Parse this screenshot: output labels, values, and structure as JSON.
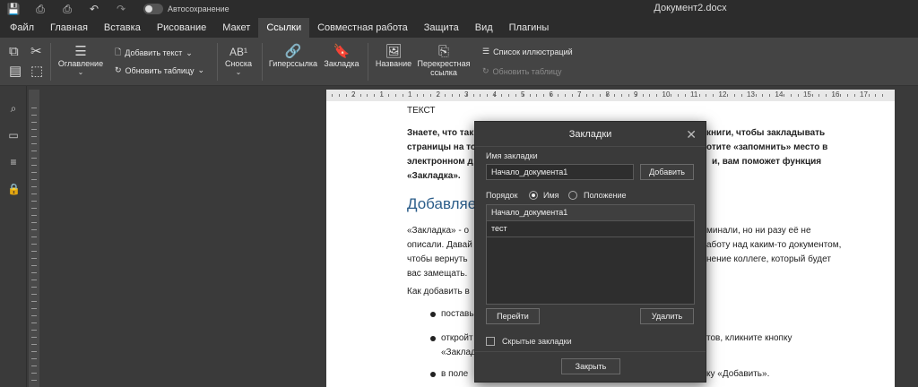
{
  "window": {
    "title": "Документ2.docx",
    "autosave_label": "Автосохранение"
  },
  "menu": {
    "items": [
      "Файл",
      "Главная",
      "Вставка",
      "Рисование",
      "Макет",
      "Ссылки",
      "Совместная работа",
      "Защита",
      "Вид",
      "Плагины"
    ],
    "active": "Ссылки"
  },
  "ribbon": {
    "toc_label": "Оглавление",
    "add_text_label": "Добавить текст",
    "update_table_label": "Обновить таблицу",
    "footnote_label": "Сноска",
    "hyperlink_label": "Гиперссылка",
    "bookmark_label": "Закладка",
    "caption_label": "Название",
    "crossref_label_1": "Перекрестная",
    "crossref_label_2": "ссылка",
    "figures_list_label": "Список иллюстраций",
    "update_table2_label": "Обновить таблицу"
  },
  "ruler": {
    "numbers": [
      "2",
      "1",
      "1",
      "2",
      "3",
      "4",
      "5",
      "6",
      "7",
      "8",
      "9",
      "10",
      "11",
      "12",
      "13",
      "14",
      "15",
      "16",
      "17"
    ]
  },
  "document": {
    "line0": "ТЕКСТ",
    "p1_line1": "Знаете, что так",
    "p1_line1_right": "книги, чтобы закладывать",
    "p1_line2": "страницы на то",
    "p1_line2_right": "отите «запомнить» место в",
    "p1_line3": "электронном д",
    "p1_line3_right": "и, вам поможет функция",
    "p1_line4": "«Закладка».",
    "heading": "Добавляем",
    "p2_line1": "«Закладка» - о",
    "p2_line1_right": "минали, но ни разу её не",
    "p2_line2": "описали. Давай",
    "p2_line2_right": "аботу над каким-то документом,",
    "p2_line3": "чтобы вернуть",
    "p2_line3_right": "нение коллеге, который будет",
    "p2_line4": "вас замещать.",
    "p3": "Как добавить в",
    "b1": "поставь",
    "b2_line1": "откройт",
    "b2_line1_right": "тов, кликните кнопку",
    "b2_line2": "«Заклад",
    "b3": "в поле",
    "b3_right": "ку «Добавить»."
  },
  "dialog": {
    "title": "Закладки",
    "name_label": "Имя закладки",
    "name_value": "Начало_документа1",
    "add_button": "Добавить",
    "order_label": "Порядок",
    "order_by_name": "Имя",
    "order_by_position": "Положение",
    "order_selected": "Имя",
    "bookmarks": [
      "Начало_документа1",
      "тест"
    ],
    "goto_button": "Перейти",
    "delete_button": "Удалить",
    "hidden_label": "Скрытые закладки",
    "hidden_checked": false,
    "close_button": "Закрыть"
  }
}
